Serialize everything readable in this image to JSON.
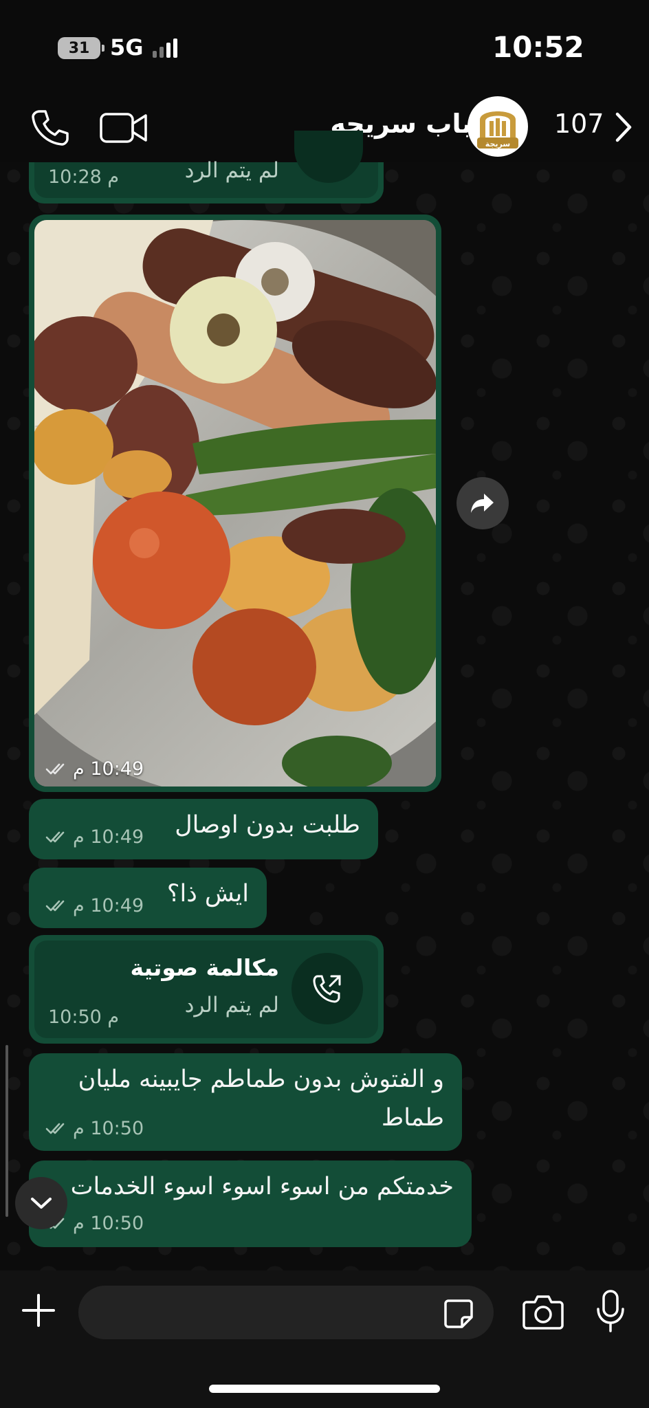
{
  "status_bar": {
    "battery": "31",
    "network": "5G",
    "time": "10:52"
  },
  "header": {
    "contact_name": "باب سريجه",
    "avatar_label": "سريجة",
    "unread_count": "107"
  },
  "messages": {
    "top_call": {
      "subtitle": "لم يتم الرد",
      "time": "10:28 م"
    },
    "photo": {
      "time": "10:49 م"
    },
    "msg1": {
      "text": "طلبت بدون اوصال",
      "time": "10:49 م"
    },
    "msg2": {
      "text": "ايش ذا؟",
      "time": "10:49 م"
    },
    "call": {
      "title": "مكالمة صوتية",
      "subtitle": "لم يتم الرد",
      "time": "10:50 م"
    },
    "msg3": {
      "line1": "و الفتوش بدون طماطم جايبينه مليان",
      "line2": "طماط",
      "time": "10:50 م"
    },
    "msg4": {
      "text": "خدمتكم من اسوء اسوء اسوء الخدمات",
      "time": "10:50 م"
    }
  },
  "input": {
    "placeholder": ""
  },
  "colors": {
    "bubble": "#134d37",
    "background": "#0c0c0c",
    "accent": "#25d366"
  },
  "icons": [
    "phone-icon",
    "video-icon",
    "chevron-right-icon",
    "forward-icon",
    "chevron-down-icon",
    "plus-icon",
    "sticker-icon",
    "camera-icon",
    "mic-icon",
    "missed-call-icon",
    "double-check-icon"
  ]
}
